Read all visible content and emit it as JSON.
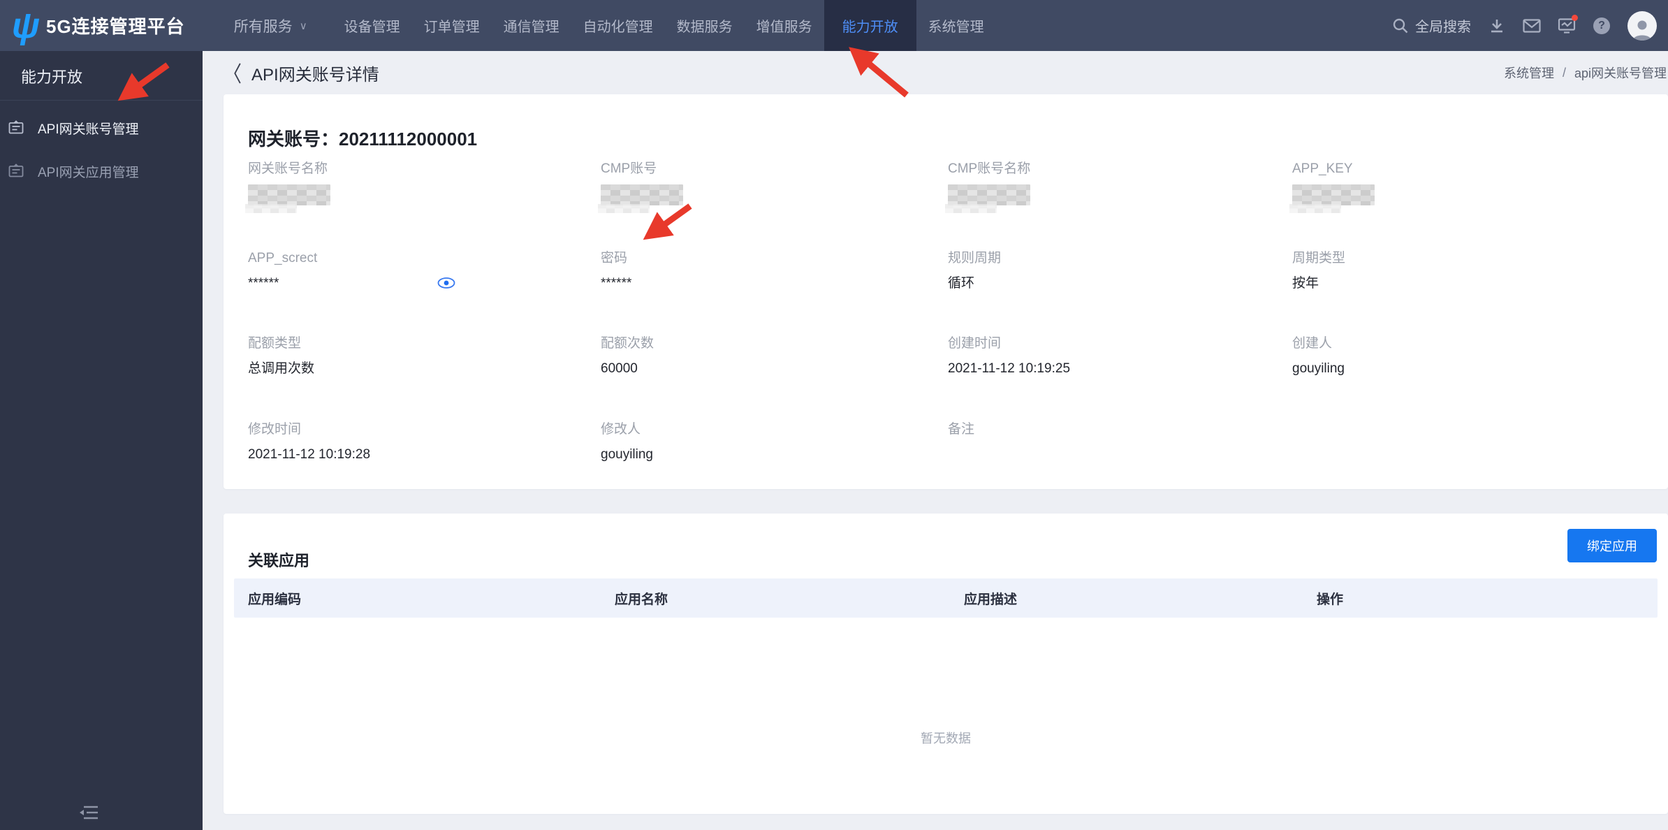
{
  "nav": {
    "logo_glyph": "ψ",
    "title": "5G连接管理平台",
    "all_services": "所有服务",
    "all_services_caret": "∨",
    "items": [
      {
        "label": "设备管理",
        "active": false
      },
      {
        "label": "订单管理",
        "active": false
      },
      {
        "label": "通信管理",
        "active": false
      },
      {
        "label": "自动化管理",
        "active": false
      },
      {
        "label": "数据服务",
        "active": false
      },
      {
        "label": "增值服务",
        "active": false
      },
      {
        "label": "能力开放",
        "active": true
      },
      {
        "label": "系统管理",
        "active": false
      }
    ],
    "search_label": "全局搜索",
    "help_glyph": "?",
    "icons": [
      "search-icon",
      "download-icon",
      "mail-icon",
      "monitor-alert-icon",
      "help-icon",
      "avatar"
    ]
  },
  "sidebar": {
    "title": "能力开放",
    "items": [
      {
        "label": "API网关账号管理",
        "active": true
      },
      {
        "label": "API网关应用管理",
        "active": false
      }
    ]
  },
  "page": {
    "back_chevron": "〈",
    "title": "API网关账号详情",
    "breadcrumb": [
      "系统管理",
      "api网关账号管理"
    ],
    "breadcrumb_sep": "/"
  },
  "detail": {
    "title": "网关账号：20211112000001",
    "fields": [
      {
        "label": "网关账号名称",
        "value": "",
        "redacted": true
      },
      {
        "label": "CMP账号",
        "value": "",
        "redacted": true
      },
      {
        "label": "CMP账号名称",
        "value": "",
        "redacted": true
      },
      {
        "label": "APP_KEY",
        "value": "",
        "redacted": true
      },
      {
        "label": "APP_screct",
        "value": "******",
        "has_eye_toggle": true
      },
      {
        "label": "密码",
        "value": "******"
      },
      {
        "label": "规则周期",
        "value": "循环"
      },
      {
        "label": "周期类型",
        "value": "按年"
      },
      {
        "label": "配额类型",
        "value": "总调用次数"
      },
      {
        "label": "配额次数",
        "value": "60000"
      },
      {
        "label": "创建时间",
        "value": "2021-11-12 10:19:25"
      },
      {
        "label": "创建人",
        "value": "gouyiling"
      },
      {
        "label": "修改时间",
        "value": "2021-11-12 10:19:28"
      },
      {
        "label": "修改人",
        "value": "gouyiling"
      },
      {
        "label": "备注",
        "value": ""
      }
    ]
  },
  "related": {
    "title": "关联应用",
    "button_label": "绑定应用",
    "columns": [
      "应用编码",
      "应用名称",
      "应用描述",
      "操作"
    ],
    "empty_text": "暂无数据"
  },
  "colors": {
    "nav_bg": "#404a63",
    "nav_active_bg": "#272e45",
    "nav_active_text": "#4e8ef7",
    "sidebar_bg": "#2e3447",
    "primary_button": "#1677f0",
    "annotation_arrow": "#e8392b",
    "table_header_bg": "#eef2fb",
    "notification_dot": "#f5483b"
  }
}
